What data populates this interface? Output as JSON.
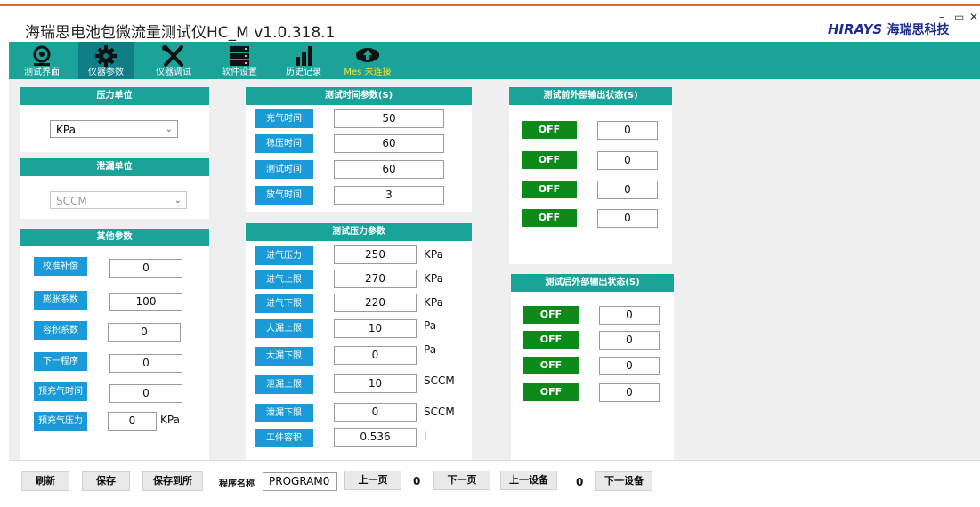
{
  "window": {
    "title": "海瑞思电池包微流量测试仪HC_M v1.0.318.1",
    "logo_text": "HIRAYS",
    "logo_cn": "海瑞思科技",
    "minimize": "–",
    "restore": "▭",
    "close": "✕"
  },
  "toolbar": [
    {
      "label": "测试界面",
      "icon": "camera-icon"
    },
    {
      "label": "仪器参数",
      "icon": "gear-icon"
    },
    {
      "label": "仪器调试",
      "icon": "tools-icon"
    },
    {
      "label": "软件设置",
      "icon": "server-icon"
    },
    {
      "label": "历史记录",
      "icon": "bar-chart-icon"
    },
    {
      "label": "Mes 未连接",
      "icon": "cloud-upload-icon"
    }
  ],
  "panels": {
    "pressure_unit": {
      "title": "压力单位",
      "value": "KPa"
    },
    "leak_unit": {
      "title": "泄漏单位",
      "value": "SCCM"
    },
    "other": {
      "title": "其他参数",
      "rows": [
        {
          "label": "校准补偿",
          "value": "0",
          "unit": ""
        },
        {
          "label": "膨胀系数",
          "value": "100",
          "unit": ""
        },
        {
          "label": "容积系数",
          "value": "0",
          "unit": ""
        },
        {
          "label": "下一程序",
          "value": "0",
          "unit": ""
        },
        {
          "label": "预充气时间",
          "value": "0",
          "unit": ""
        },
        {
          "label": "预充气压力",
          "value": "0",
          "unit": "KPa"
        }
      ]
    },
    "time": {
      "title": "测试时间参数(S)",
      "rows": [
        {
          "label": "充气时间",
          "value": "50"
        },
        {
          "label": "稳压时间",
          "value": "60"
        },
        {
          "label": "测试时间",
          "value": "60"
        },
        {
          "label": "放气时间",
          "value": "3"
        }
      ]
    },
    "pressure": {
      "title": "测试压力参数",
      "rows": [
        {
          "label": "进气压力",
          "value": "250",
          "unit": "KPa"
        },
        {
          "label": "进气上限",
          "value": "270",
          "unit": "KPa"
        },
        {
          "label": "进气下限",
          "value": "220",
          "unit": "KPa"
        },
        {
          "label": "大漏上限",
          "value": "10",
          "unit": "Pa"
        },
        {
          "label": "大漏下限",
          "value": "0",
          "unit": "Pa"
        },
        {
          "label": "泄漏上限",
          "value": "10",
          "unit": "SCCM"
        },
        {
          "label": "泄漏下限",
          "value": "0",
          "unit": "SCCM"
        },
        {
          "label": "工件容积",
          "value": "0.536",
          "unit": "l"
        }
      ]
    },
    "before_output": {
      "title": "测试前外部输出状态(S)",
      "rows": [
        {
          "state": "OFF",
          "value": "0"
        },
        {
          "state": "OFF",
          "value": "0"
        },
        {
          "state": "OFF",
          "value": "0"
        },
        {
          "state": "OFF",
          "value": "0"
        }
      ]
    },
    "after_output": {
      "title": "测试后外部输出状态(S)",
      "rows": [
        {
          "state": "OFF",
          "value": "0"
        },
        {
          "state": "OFF",
          "value": "0"
        },
        {
          "state": "OFF",
          "value": "0"
        },
        {
          "state": "OFF",
          "value": "0"
        }
      ]
    }
  },
  "bottom": {
    "refresh": "刷新",
    "save": "保存",
    "save_all": "保存到所",
    "program_name_label": "程序名称",
    "program_name": "PROGRAM0",
    "prev_page": "上一页",
    "page_value": "0",
    "next_page": "下一页",
    "prev_device": "上一设备",
    "device_value": "0",
    "next_device": "下一设备"
  },
  "colors": {
    "teal": "#1aa399",
    "blue_label": "#1a9ad6",
    "off_green": "#0d8a1a",
    "mes_yellow": "#f3e533"
  }
}
